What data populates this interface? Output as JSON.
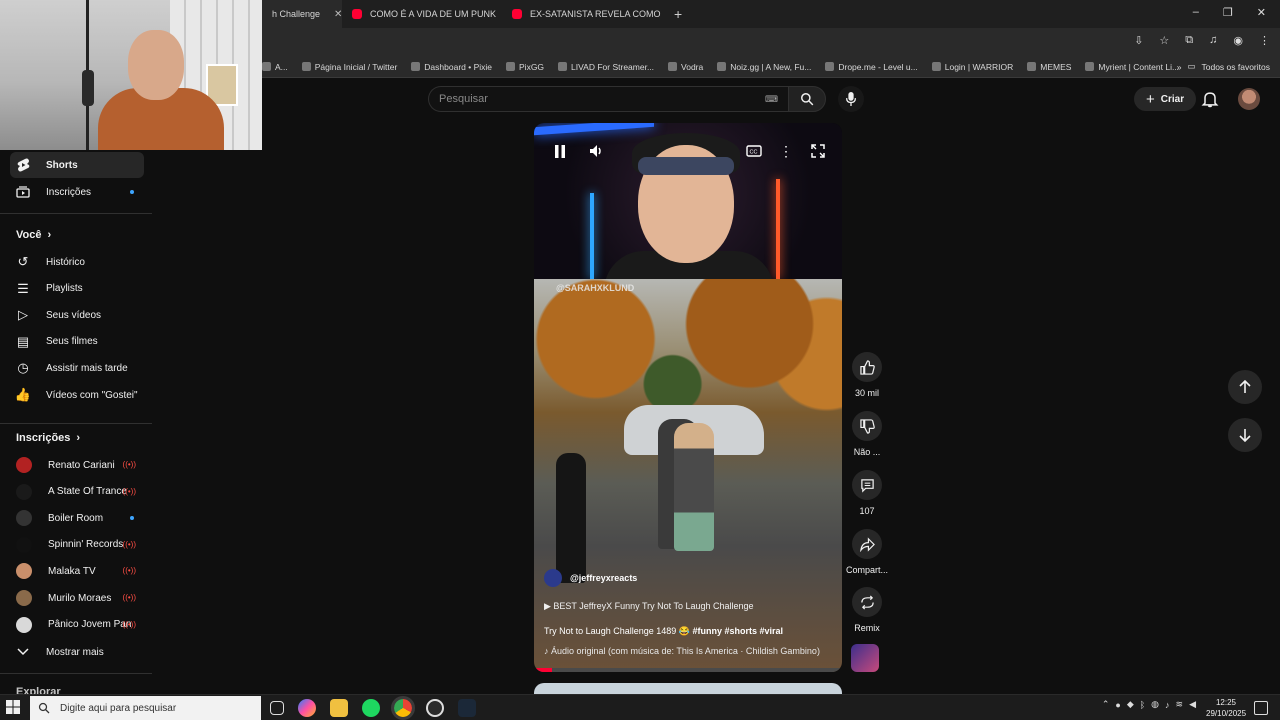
{
  "browser": {
    "tabs": [
      {
        "label": "h Challenge",
        "active": true
      },
      {
        "label": "COMO É A VIDA DE UM PUNK",
        "active": false
      },
      {
        "label": "EX-SATANISTA REVELA COMO",
        "active": false
      }
    ],
    "new_tab": "+",
    "window_controls": [
      "–",
      "❐",
      "✕"
    ],
    "bookmarks": [
      {
        "label": "A...",
        "icon": "bookmark-icon"
      },
      {
        "label": "Página Inicial / Twitter",
        "icon": "x-icon"
      },
      {
        "label": "Dashboard • Pixie",
        "icon": "pixie-icon"
      },
      {
        "label": "PixGG",
        "icon": "pixgg-icon"
      },
      {
        "label": "LIVAD For Streamer...",
        "icon": "livad-icon"
      },
      {
        "label": "Vodra",
        "icon": "vodra-icon"
      },
      {
        "label": "Noiz.gg | A New, Fu...",
        "icon": "noiz-icon"
      },
      {
        "label": "Drope.me - Level u...",
        "icon": "drope-icon"
      },
      {
        "label": "Login | WARRIOR",
        "icon": "warrior-icon"
      },
      {
        "label": "MEMES",
        "icon": "folder-icon"
      },
      {
        "label": "Myrient | Content Li...",
        "icon": "myrient-icon"
      }
    ],
    "bookmarks_overflow": "»",
    "all_bookmarks": "Todos os favoritos"
  },
  "youtube": {
    "search": {
      "placeholder": "Pesquisar",
      "keyboard_hint": "⌨"
    },
    "create_label": "Criar",
    "sidebar": {
      "main": [
        {
          "label": "Shorts",
          "active": true,
          "icon": "shorts-icon"
        },
        {
          "label": "Inscrições",
          "active": false,
          "icon": "subscriptions-icon"
        }
      ],
      "you_title": "Você",
      "you_items": [
        {
          "label": "Histórico",
          "icon": "history-icon"
        },
        {
          "label": "Playlists",
          "icon": "playlists-icon"
        },
        {
          "label": "Seus vídeos",
          "icon": "your-videos-icon"
        },
        {
          "label": "Seus filmes",
          "icon": "your-movies-icon"
        },
        {
          "label": "Assistir mais tarde",
          "icon": "watch-later-icon"
        },
        {
          "label": "Vídeos com \"Gostei\"",
          "icon": "liked-icon"
        }
      ],
      "subs_title": "Inscrições",
      "subscriptions": [
        {
          "label": "Renato Cariani",
          "status": "live",
          "color": "#b22222"
        },
        {
          "label": "A State Of Trance",
          "status": "live",
          "color": "#1a1a1a"
        },
        {
          "label": "Boiler Room",
          "status": "new",
          "color": "#333333"
        },
        {
          "label": "Spinnin' Records",
          "status": "live",
          "color": "#111111"
        },
        {
          "label": "Malaka TV",
          "status": "live",
          "color": "#c98f6b"
        },
        {
          "label": "Murilo Moraes",
          "status": "live",
          "color": "#8a6a4a"
        },
        {
          "label": "Pânico Jovem Pan",
          "status": "live",
          "color": "#d9d9d9"
        }
      ],
      "show_more": "Mostrar mais",
      "explore_title": "Explorar"
    },
    "short": {
      "overlay_handle": "@SARAHXKLUND",
      "channel": "@jeffreyxreacts",
      "link_text": "▶ BEST JeffreyX Funny Try Not To Laugh Challenge",
      "title_text": "Try Not to Laugh Challenge 1489 😂",
      "hashtags": "#funny #shorts #viral",
      "audio": "♪ Áudio original (com música de: This Is America · Childish Gambino)",
      "progress": 0.06
    },
    "actions": {
      "like_count": "30 mil",
      "dislike_label": "Não ...",
      "comments_count": "107",
      "share_label": "Compart...",
      "remix_label": "Remix"
    }
  },
  "taskbar": {
    "search_placeholder": "Digite aqui para pesquisar",
    "time": "12:25",
    "date": "29/10/2025"
  }
}
